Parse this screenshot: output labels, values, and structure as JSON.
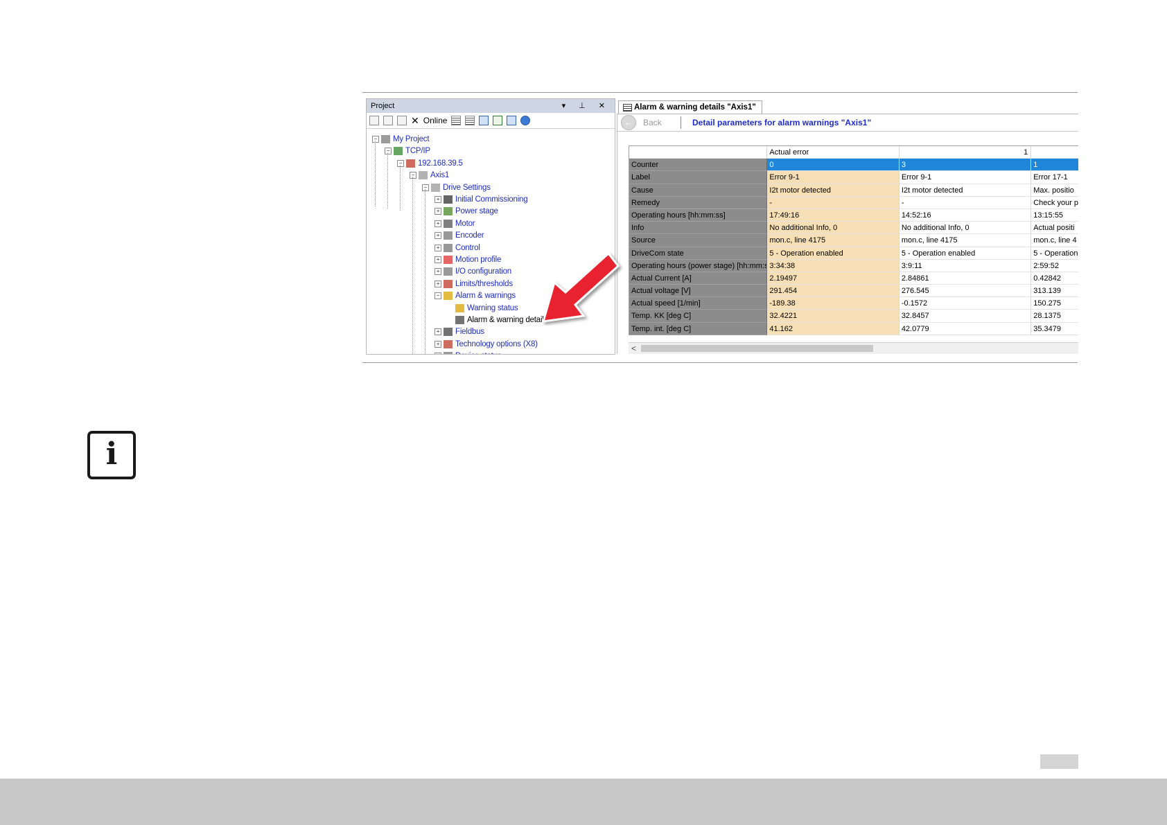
{
  "project_pane": {
    "title": "Project",
    "controls": "▾ ⊥ ✕",
    "toolbar": {
      "online_label": "Online"
    },
    "tree": [
      {
        "label": "My Project",
        "expander": "−"
      },
      {
        "label": "TCP/IP",
        "expander": "−"
      },
      {
        "label": "192.168.39.5",
        "expander": "−"
      },
      {
        "label": "Axis1",
        "expander": "−"
      },
      {
        "label": "Drive Settings",
        "expander": "−"
      },
      {
        "label": "Initial Commissioning",
        "expander": "+"
      },
      {
        "label": "Power stage",
        "expander": "+"
      },
      {
        "label": "Motor",
        "expander": "+"
      },
      {
        "label": "Encoder",
        "expander": "+"
      },
      {
        "label": "Control",
        "expander": "+"
      },
      {
        "label": "Motion profile",
        "expander": "+"
      },
      {
        "label": "I/O configuration",
        "expander": "+"
      },
      {
        "label": "Limits/thresholds",
        "expander": "+"
      },
      {
        "label": "Alarm & warnings",
        "expander": "−"
      },
      {
        "label": "Warning status",
        "expander": ""
      },
      {
        "label": "Alarm & warning details",
        "expander": ""
      },
      {
        "label": "Fieldbus",
        "expander": "+"
      },
      {
        "label": "Technology options (X8)",
        "expander": "+"
      },
      {
        "label": "Device status",
        "expander": "+"
      }
    ]
  },
  "detail_pane": {
    "tab_title": "Alarm & warning details \"Axis1\"",
    "back_label": "Back",
    "back_icon": "arrow-left-icon",
    "heading": "Detail parameters for alarm  warnings \"Axis1\"",
    "table": {
      "headers": [
        "",
        "Actual error",
        "1",
        ""
      ],
      "rows": [
        [
          "Counter",
          "0",
          "3",
          "1"
        ],
        [
          "Label",
          "Error 9-1",
          "Error 9-1",
          "Error 17-1"
        ],
        [
          "Cause",
          "I2t motor detected",
          "I2t motor detected",
          "Max. positio"
        ],
        [
          "Remedy",
          "-",
          "-",
          "Check your p"
        ],
        [
          "Operating hours [hh:mm:ss]",
          "17:49:16",
          "14:52:16",
          "13:15:55"
        ],
        [
          "Info",
          "No additional Info, 0",
          "No additional Info, 0",
          "Actual positi"
        ],
        [
          "Source",
          "mon.c, line 4175",
          "mon.c, line 4175",
          "mon.c, line 4"
        ],
        [
          "DriveCom state",
          "5 - Operation enabled",
          "5 - Operation enabled",
          "5 - Operation"
        ],
        [
          "Operating hours (power stage) [hh:mm:ss]",
          "3:34:38",
          "3:9:11",
          "2:59:52"
        ],
        [
          "Actual Current   [A]",
          "2.19497",
          "2.84861",
          "0.42842"
        ],
        [
          "Actual voltage   [V]",
          "291.454",
          "276.545",
          "313.139"
        ],
        [
          "Actual speed   [1/min]",
          "-189.38",
          "-0.1572",
          "150.275"
        ],
        [
          "Temp. KK   [deg C]",
          "32.4221",
          "32.8457",
          "28.1375"
        ],
        [
          "Temp. int.   [deg C]",
          "41.162",
          "42.0779",
          "35.3479"
        ]
      ]
    }
  },
  "colors": {
    "highlight_arrow": "#e8212e",
    "selected_row": "#1f86d9",
    "current_column": "#f7dfb5",
    "label_column": "#8c8c8c",
    "footer": "#c8c8c8"
  },
  "info_icon": "info-icon"
}
